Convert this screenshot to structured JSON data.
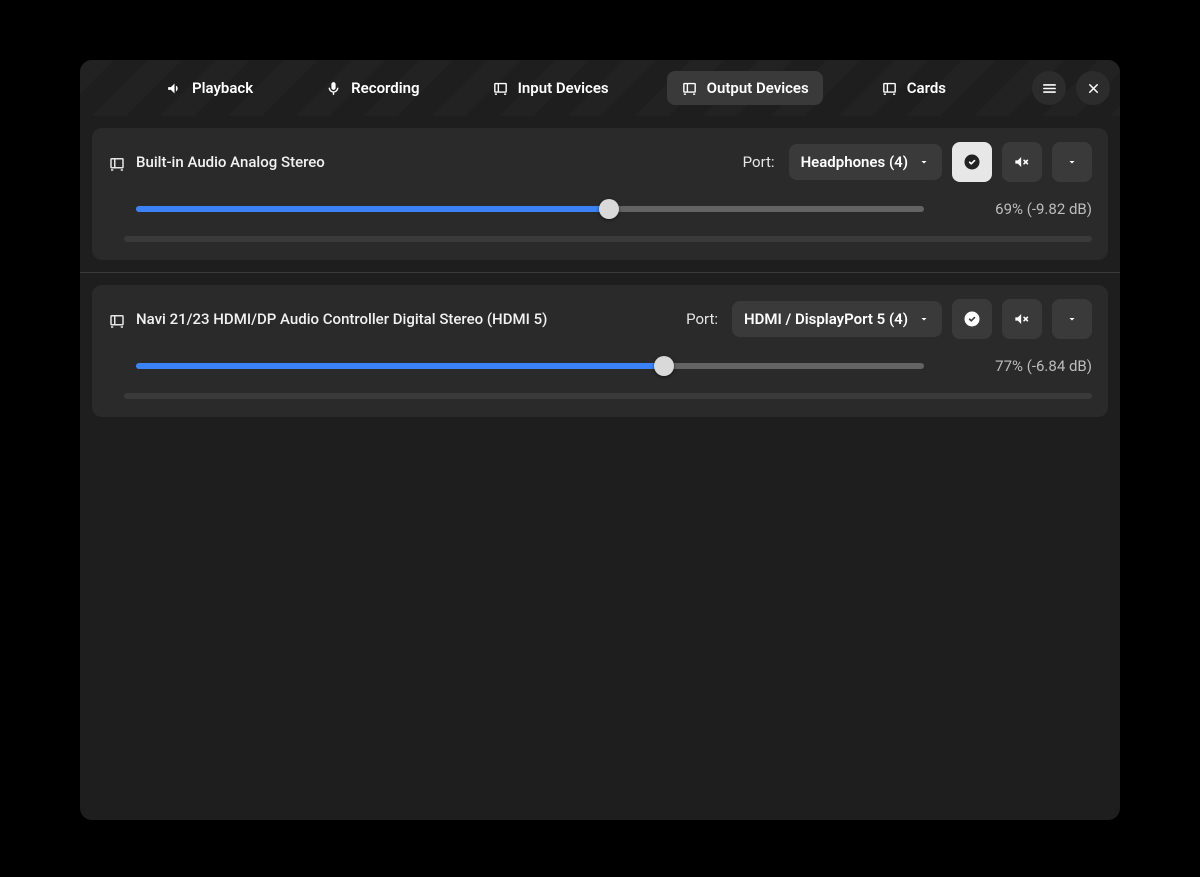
{
  "tabs": {
    "playback": "Playback",
    "recording": "Recording",
    "input": "Input Devices",
    "output": "Output Devices",
    "cards": "Cards"
  },
  "activeTab": "output",
  "devices": [
    {
      "name": "Built-in Audio Analog Stereo",
      "port_label": "Port:",
      "port_selected": "Headphones (4)",
      "fallback_active": true,
      "muted": false,
      "volume_pct": 69,
      "readout": "69%  (-9.82 dB)",
      "slider_fill_pct": 60
    },
    {
      "name": "Navi 21/23 HDMI/DP Audio Controller Digital Stereo (HDMI 5)",
      "port_label": "Port:",
      "port_selected": "HDMI / DisplayPort 5 (4)",
      "fallback_active": false,
      "muted": false,
      "volume_pct": 77,
      "readout": "77%  (-6.84 dB)",
      "slider_fill_pct": 67
    }
  ]
}
